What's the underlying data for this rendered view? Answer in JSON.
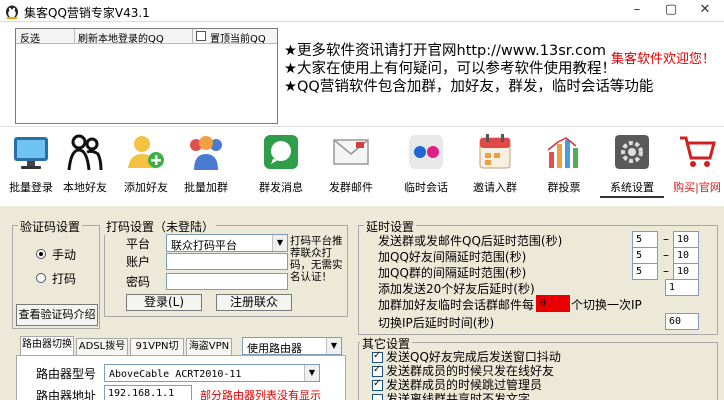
{
  "window": {
    "title": "集客QQ营销专家V43.1",
    "controls": [
      "minimize",
      "maximize",
      "close"
    ]
  },
  "top_list": {
    "columns": [
      "反选",
      "刷新本地登录的QQ",
      "置顶当前QQ"
    ]
  },
  "info": {
    "lines": [
      "★更多软件资讯请打开官网http://www.13sr.com",
      "★大家在使用上有何疑问，可以参考软件使用教程！",
      "★QQ营销软件包含加群，加好友，群发，临时会话等功能"
    ],
    "welcome": "集客软件欢迎您！"
  },
  "toolbar": [
    {
      "label": "批量登录",
      "icon": "monitor-icon"
    },
    {
      "label": "本地好友",
      "icon": "people-outline-icon"
    },
    {
      "label": "添加好友",
      "icon": "add-user-icon"
    },
    {
      "label": "批量加群",
      "icon": "group-icon"
    },
    {
      "label": "群发消息",
      "icon": "chat-icon"
    },
    {
      "label": "发群邮件",
      "icon": "mail-icon"
    },
    {
      "label": "临时会话",
      "icon": "flickr-icon"
    },
    {
      "label": "邀请入群",
      "icon": "calendar-icon"
    },
    {
      "label": "群投票",
      "icon": "bar-chart-icon"
    },
    {
      "label": "系统设置",
      "icon": "settings-icon"
    },
    {
      "label": "购买|官网",
      "icon": "cart-icon"
    }
  ],
  "captcha": {
    "title": "验证码设置",
    "options": [
      "手动",
      "打码"
    ],
    "selected": "手动",
    "help_button": "查看验证码介绍"
  },
  "coding": {
    "title": "打码设置（未登陆）",
    "platform_label": "平台",
    "platform_value": "联众打码平台",
    "account_label": "账户",
    "password_label": "密码",
    "login_button": "登录(L)",
    "register_button": "注册联众",
    "note": "打码平台推荐联众打码，无需实名认证！"
  },
  "delay": {
    "title": "延时设置",
    "rows": [
      {
        "label": "发送群或发邮件QQ后延时范围(秒)",
        "from": "5",
        "to": "10"
      },
      {
        "label": "加QQ好友间隔延时范围(秒)",
        "from": "5",
        "to": "10"
      },
      {
        "label": "加QQ群的间隔延时范围(秒)",
        "from": "5",
        "to": "10"
      },
      {
        "label": "添加发送20个好友后延时(秒)",
        "value": "1"
      }
    ],
    "switch_prefix": "加群加好友临时会话群邮件每",
    "switch_value": "0",
    "switch_suffix": "个切换一次IP",
    "ip_label": "切换IP后延时时间(秒)",
    "ip_value": "60"
  },
  "other": {
    "title": "其它设置",
    "checks": [
      {
        "label": "发送QQ好友完成后发送窗口抖动",
        "checked": true
      },
      {
        "label": "发送群成员的时候只发在线好友",
        "checked": true
      },
      {
        "label": "发送群成员的时候跳过管理员",
        "checked": true
      },
      {
        "label": "发送离线群共享时不发文字",
        "checked": false
      }
    ]
  },
  "network": {
    "tabs": [
      "路由器切换",
      "ADSL拨号",
      "91VPN切换",
      "海盗VPN"
    ],
    "active_tab": "路由器切换",
    "mode_value": "使用路由器",
    "model_label": "路由器型号",
    "model_value": "AboveCable ACRT2010-11",
    "address_label": "路由器地址",
    "address_value": "192.168.1.1",
    "warning": "部分路由器列表没有显示"
  },
  "colors": {
    "accent_red": "#e00000",
    "switch_bg": "#e80000"
  }
}
